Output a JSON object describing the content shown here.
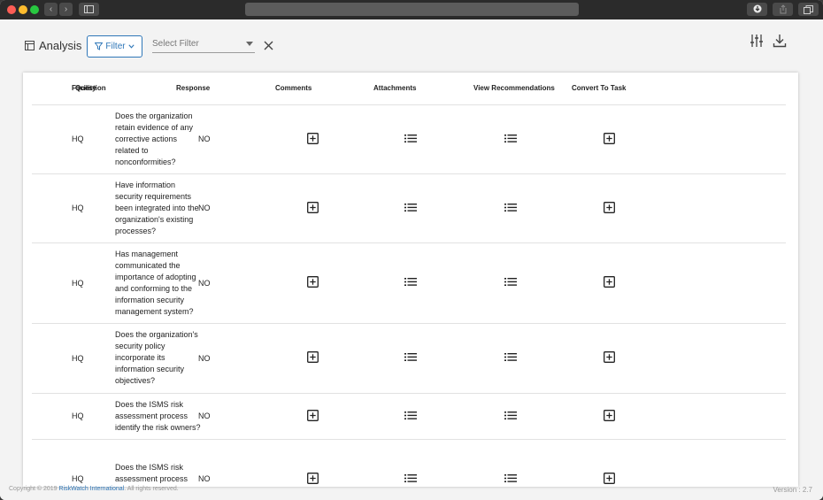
{
  "header": {
    "title": "Analysis",
    "filter_label": "Filter",
    "select_placeholder": "Select Filter"
  },
  "table": {
    "columns": [
      "Facility",
      "Question",
      "Response",
      "Comments",
      "Attachments",
      "View Recommendations",
      "Convert To Task"
    ],
    "rows": [
      {
        "facility": "HQ",
        "question": "Does the organization retain evidence of any corrective actions related to nonconformities?",
        "response": "NO"
      },
      {
        "facility": "HQ",
        "question": "Have information security requirements been integrated into the organization's existing processes?",
        "response": "NO"
      },
      {
        "facility": "HQ",
        "question": "Has management communicated the importance of adopting and conforming to the information security management system?",
        "response": "NO"
      },
      {
        "facility": "HQ",
        "question": "Does the organization's security policy incorporate its information security objectives?",
        "response": "NO"
      },
      {
        "facility": "HQ",
        "question": "Does the ISMS risk assessment process identify the risk owners?",
        "response": "NO"
      },
      {
        "facility": "HQ",
        "question": "Does the ISMS risk assessment process compare assessment",
        "response": "NO"
      }
    ]
  },
  "footer": {
    "copyright_prefix": "Copyright © 2019 ",
    "company": "RiskWatch International",
    "copyright_suffix": ". All rights reserved.",
    "version": "Version : 2.7"
  },
  "icons": {
    "comments": "plus-square-icon",
    "attachments": "list-icon",
    "recommendations": "list-icon",
    "task": "plus-square-icon",
    "settings": "sliders-icon",
    "download": "download-icon"
  },
  "colors": {
    "accent": "#2f77b8"
  }
}
